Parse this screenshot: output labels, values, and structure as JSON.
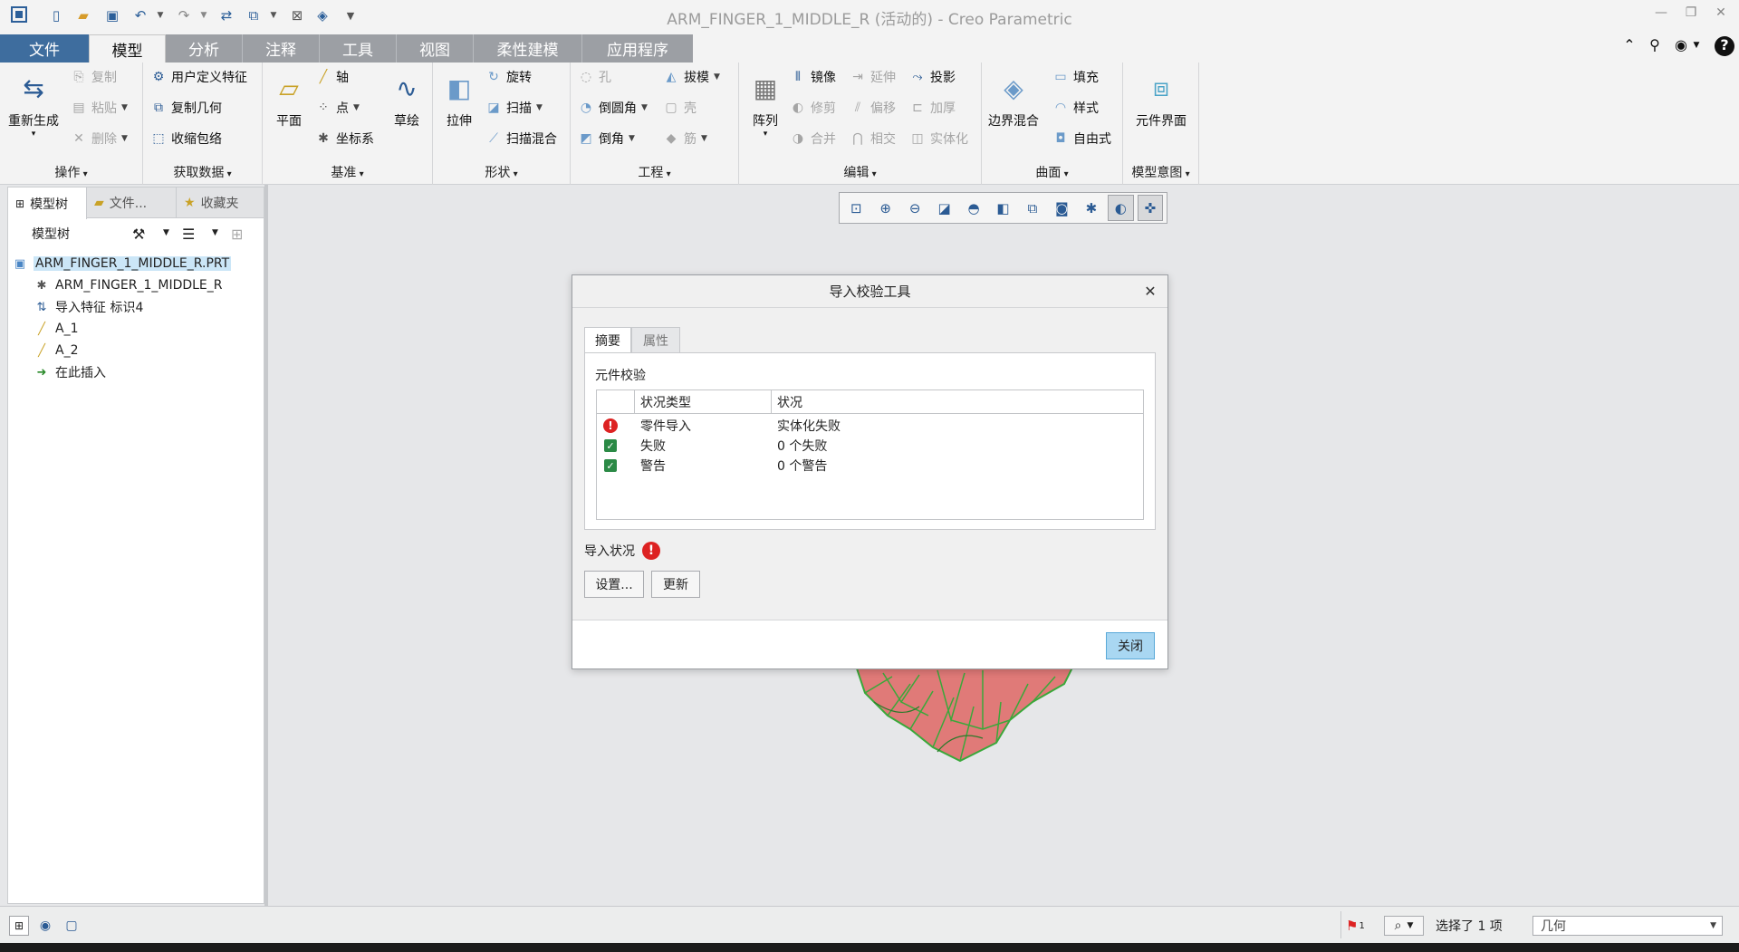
{
  "window": {
    "title": "ARM_FINGER_1_MIDDLE_R (活动的) - Creo Parametric"
  },
  "tabs": [
    {
      "label": "文件"
    },
    {
      "label": "模型"
    },
    {
      "label": "分析"
    },
    {
      "label": "注释"
    },
    {
      "label": "工具"
    },
    {
      "label": "视图"
    },
    {
      "label": "柔性建模"
    },
    {
      "label": "应用程序"
    }
  ],
  "ribbon": {
    "operations": {
      "label": "操作",
      "regenerate": "重新生成",
      "copy": "复制",
      "paste": "粘贴",
      "delete": "删除"
    },
    "get_data": {
      "label": "获取数据",
      "udf": "用户定义特征",
      "copy_geom": "复制几何",
      "shrinkwrap": "收缩包络"
    },
    "datum": {
      "label": "基准",
      "plane": "平面",
      "axis": "轴",
      "point": "点",
      "csys": "坐标系",
      "sketch": "草绘"
    },
    "shapes": {
      "label": "形状",
      "extrude": "拉伸",
      "revolve": "旋转",
      "sweep": "扫描",
      "swept_blend": "扫描混合"
    },
    "engineering": {
      "label": "工程",
      "hole": "孔",
      "round": "倒圆角",
      "chamfer": "倒角",
      "draft": "拔模",
      "shell": "壳",
      "rib": "筋"
    },
    "editing": {
      "label": "编辑",
      "pattern": "阵列",
      "mirror": "镜像",
      "trim": "修剪",
      "merge": "合并",
      "extend": "延伸",
      "offset": "偏移",
      "intersect": "相交",
      "project": "投影",
      "thicken": "加厚",
      "solidify": "实体化"
    },
    "surfaces": {
      "label": "曲面",
      "boundary_blend": "边界混合",
      "fill": "填充",
      "style": "样式",
      "freestyle": "自由式"
    },
    "model_intent": {
      "label": "模型意图",
      "component_interface": "元件界面"
    }
  },
  "left_panel": {
    "tabs": [
      {
        "label": "模型树"
      },
      {
        "label": "文件..."
      },
      {
        "label": "收藏夹"
      }
    ],
    "tree_header": "模型树",
    "items": [
      {
        "label": "ARM_FINGER_1_MIDDLE_R.PRT"
      },
      {
        "label": "ARM_FINGER_1_MIDDLE_R"
      },
      {
        "label": "导入特征 标识4"
      },
      {
        "label": "A_1"
      },
      {
        "label": "A_2"
      },
      {
        "label": "在此插入"
      }
    ]
  },
  "dialog": {
    "title": "导入校验工具",
    "tabs": [
      {
        "label": "摘要"
      },
      {
        "label": "属性"
      }
    ],
    "section_title": "元件校验",
    "columns": [
      "状况类型",
      "状况"
    ],
    "rows": [
      {
        "icon": "error-icon",
        "type": "零件导入",
        "status": "实体化失败"
      },
      {
        "icon": "check-icon",
        "type": "失败",
        "status": "0 个失败"
      },
      {
        "icon": "check-icon",
        "type": "警告",
        "status": "0 个警告"
      }
    ],
    "import_status_label": "导入状况",
    "settings_button": "设置...",
    "update_button": "更新",
    "close_button": "关闭"
  },
  "status_bar": {
    "flag_count": "1",
    "selection_text": "选择了 1 项",
    "filter_value": "几何"
  },
  "colors": {
    "file_tab": "#3e6d9e",
    "tab_strip": "#9c9fa4",
    "model_fill": "#e07a78",
    "model_edges": "#3aa83a",
    "error": "#dd2222",
    "check": "#2b8a46",
    "close_button": "#a9d7f2"
  }
}
